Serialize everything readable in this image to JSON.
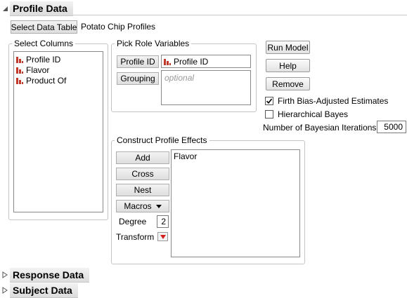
{
  "profile_section": {
    "title": "Profile Data"
  },
  "select_data_table": {
    "button_label": "Select Data Table",
    "table_name": "Potato Chip Profiles"
  },
  "select_columns": {
    "label": "Select Columns",
    "items": [
      {
        "name": "Profile ID",
        "icon": "nominal-column-icon"
      },
      {
        "name": "Flavor",
        "icon": "nominal-column-icon"
      },
      {
        "name": "Product Of",
        "icon": "nominal-column-icon"
      }
    ]
  },
  "pick_role": {
    "label": "Pick Role Variables",
    "profile_id_button": "Profile ID",
    "profile_id_value": "Profile ID",
    "grouping_button": "Grouping",
    "grouping_placeholder": "optional"
  },
  "actions": {
    "run_model": "Run Model",
    "help": "Help",
    "remove": "Remove"
  },
  "options": {
    "firth_label": "Firth Bias-Adjusted Estimates",
    "firth_checked": true,
    "hierarchical_label": "Hierarchical Bayes",
    "hierarchical_checked": false,
    "iterations_label": "Number of Bayesian Iterations",
    "iterations_value": "5000"
  },
  "construct_effects": {
    "label": "Construct Profile Effects",
    "add": "Add",
    "cross": "Cross",
    "nest": "Nest",
    "macros": "Macros",
    "degree_label": "Degree",
    "degree_value": "2",
    "transform_label": "Transform",
    "effects": [
      "Flavor"
    ]
  },
  "response_section": {
    "title": "Response Data"
  },
  "subject_section": {
    "title": "Subject Data"
  },
  "colors": {
    "nominal_icon": "#c0392b",
    "transform_red": "#d62020",
    "frame_border": "#c4c4c4"
  }
}
